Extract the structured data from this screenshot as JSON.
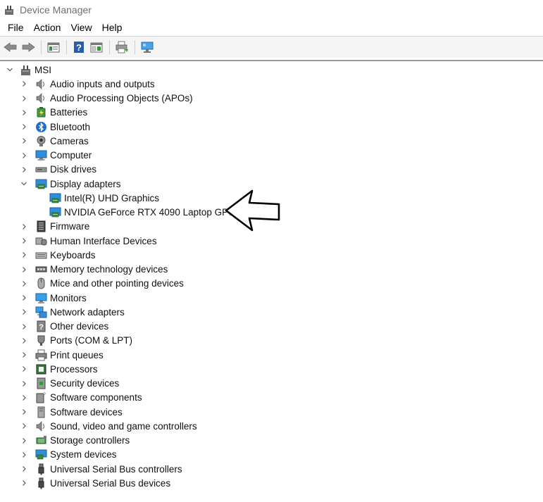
{
  "window": {
    "title": "Device Manager"
  },
  "menu": [
    "File",
    "Action",
    "View",
    "Help"
  ],
  "toolbar": [
    {
      "icon": "back-arrow-icon"
    },
    {
      "icon": "forward-arrow-icon"
    },
    {
      "icon": "properties-pane-icon"
    },
    {
      "icon": "help-icon"
    },
    {
      "icon": "console-view-icon"
    },
    {
      "icon": "print-icon"
    },
    {
      "icon": "monitor-scan-icon"
    }
  ],
  "tree": {
    "root": {
      "label": "MSI",
      "expanded": true
    },
    "categories": [
      {
        "label": "Audio inputs and outputs",
        "icon": "speaker-icon"
      },
      {
        "label": "Audio Processing Objects (APOs)",
        "icon": "speaker-icon"
      },
      {
        "label": "Batteries",
        "icon": "battery-icon"
      },
      {
        "label": "Bluetooth",
        "icon": "bluetooth-icon"
      },
      {
        "label": "Cameras",
        "icon": "camera-icon"
      },
      {
        "label": "Computer",
        "icon": "computer-icon"
      },
      {
        "label": "Disk drives",
        "icon": "disk-drive-icon"
      },
      {
        "label": "Display adapters",
        "icon": "display-adapter-icon",
        "expanded": true,
        "children": [
          {
            "label": "Intel(R) UHD Graphics",
            "icon": "display-adapter-icon"
          },
          {
            "label": "NVIDIA GeForce RTX 4090 Laptop GPU",
            "icon": "display-adapter-icon"
          }
        ]
      },
      {
        "label": "Firmware",
        "icon": "firmware-icon"
      },
      {
        "label": "Human Interface Devices",
        "icon": "hid-icon"
      },
      {
        "label": "Keyboards",
        "icon": "keyboard-icon"
      },
      {
        "label": "Memory technology devices",
        "icon": "memory-icon"
      },
      {
        "label": "Mice and other pointing devices",
        "icon": "mouse-icon"
      },
      {
        "label": "Monitors",
        "icon": "monitor-icon"
      },
      {
        "label": "Network adapters",
        "icon": "network-icon"
      },
      {
        "label": "Other devices",
        "icon": "other-device-icon"
      },
      {
        "label": "Ports (COM & LPT)",
        "icon": "port-icon"
      },
      {
        "label": "Print queues",
        "icon": "printer-icon"
      },
      {
        "label": "Processors",
        "icon": "processor-icon"
      },
      {
        "label": "Security devices",
        "icon": "security-icon"
      },
      {
        "label": "Software components",
        "icon": "software-component-icon"
      },
      {
        "label": "Software devices",
        "icon": "software-device-icon"
      },
      {
        "label": "Sound, video and game controllers",
        "icon": "speaker-icon"
      },
      {
        "label": "Storage controllers",
        "icon": "storage-icon"
      },
      {
        "label": "System devices",
        "icon": "system-device-icon"
      },
      {
        "label": "Universal Serial Bus controllers",
        "icon": "usb-icon"
      },
      {
        "label": "Universal Serial Bus devices",
        "icon": "usb-icon"
      }
    ]
  },
  "colors": {
    "accent": "#1e6fbf",
    "chevron": "#555555"
  }
}
